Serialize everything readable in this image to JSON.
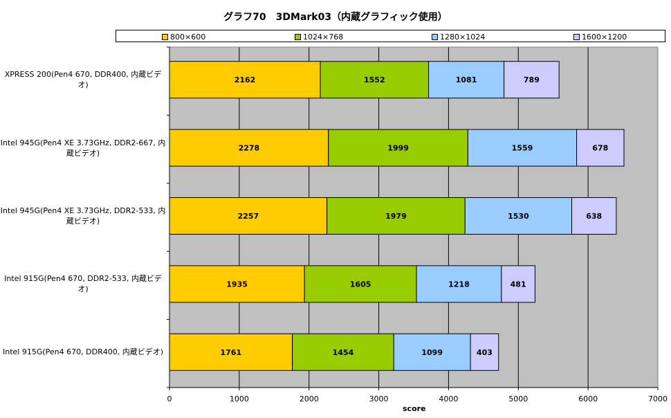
{
  "chart_data": {
    "type": "bar",
    "orientation": "horizontal",
    "stacked": true,
    "title": "グラフ70　3DMark03（内蔵グラフィック使用）",
    "xlabel": "score",
    "ylabel": "",
    "xlim": [
      0,
      7000
    ],
    "xticks": [
      0,
      1000,
      2000,
      3000,
      4000,
      5000,
      6000,
      7000
    ],
    "grid": true,
    "legend_position": "top",
    "categories": [
      "XPRESS 200(Pen4 670, DDR400, 内蔵ビデオ)",
      "Intel 945G(Pen4 XE 3.73GHz, DDR2-667, 内蔵ビデオ)",
      "Intel 945G(Pen4 XE 3.73GHz, DDR2-533, 内蔵ビデオ)",
      "Intel 915G(Pen4 670, DDR2-533, 内蔵ビデオ)",
      "Intel 915G(Pen4 670, DDR400, 内蔵ビデオ)"
    ],
    "series": [
      {
        "name": "800×600",
        "color": "#ffcc00",
        "values": [
          2162,
          2278,
          2257,
          1935,
          1761
        ]
      },
      {
        "name": "1024×768",
        "color": "#99cc00",
        "values": [
          1552,
          1999,
          1979,
          1605,
          1454
        ]
      },
      {
        "name": "1280×1024",
        "color": "#99ccff",
        "values": [
          1081,
          1559,
          1530,
          1218,
          1099
        ]
      },
      {
        "name": "1600×1200",
        "color": "#ccccff",
        "values": [
          789,
          678,
          638,
          481,
          403
        ]
      }
    ],
    "plot_background": "#c0c0c0"
  }
}
